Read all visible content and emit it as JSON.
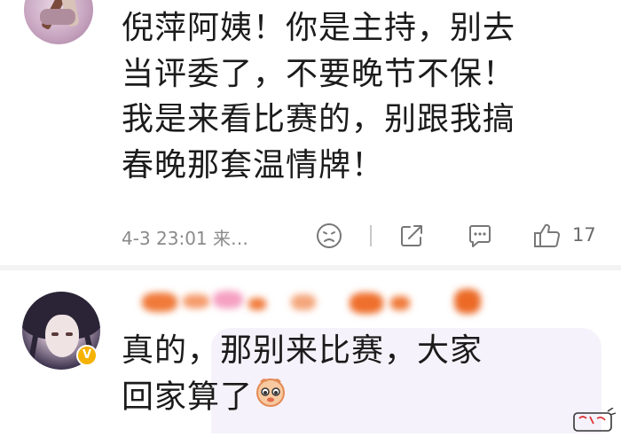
{
  "comment1": {
    "text_lines": [
      "倪萍阿姨！你是主持，别去",
      "当评委了，不要晚节不保！",
      "我是来看比赛的，别跟我搞",
      "春晚那套温情牌！"
    ],
    "timestamp": "4-3 23:01 来…",
    "like_count": "17",
    "icons": [
      "dislike-icon",
      "share-icon",
      "comment-icon",
      "like-icon"
    ]
  },
  "comment2": {
    "text_lines": [
      "真的，那别来比赛，大家",
      "回家算了"
    ],
    "badge": "V",
    "emoji": "cute-face-sticker"
  },
  "colors": {
    "text": "#1b1b1b",
    "meta": "#8a8a8a",
    "separator": "#f3f3f3",
    "badge": "#f6b200",
    "bubble": "#f6f2fb",
    "blurred_name": "#f07a3a"
  }
}
